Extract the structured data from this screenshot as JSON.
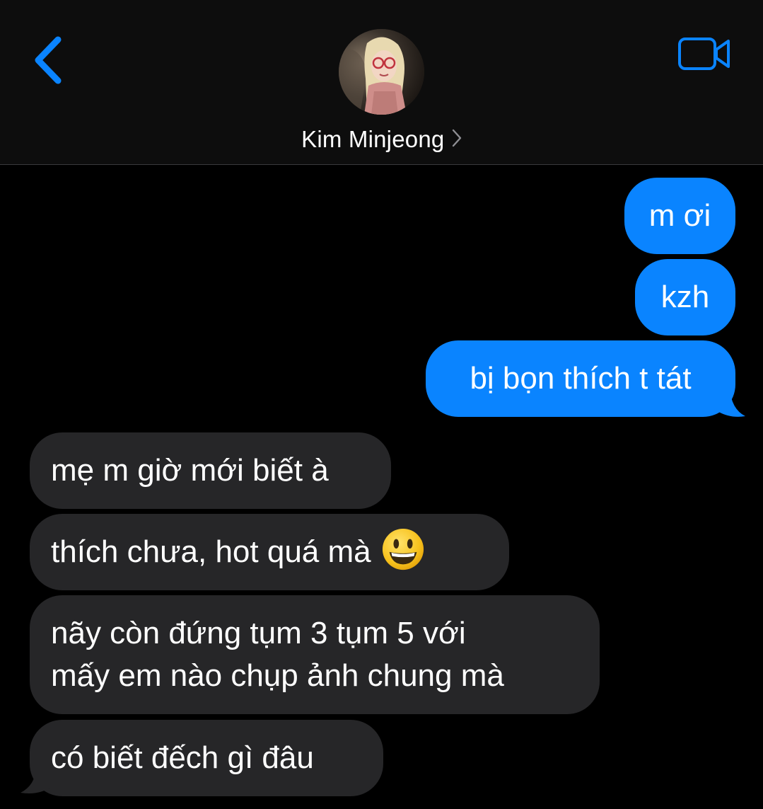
{
  "header": {
    "contact_name": "Kim Minjeong",
    "back_icon": "chevron-left-icon",
    "video_icon": "video-camera-icon",
    "accent_color": "#0a84ff"
  },
  "messages": [
    {
      "direction": "sent",
      "text": "m ơi"
    },
    {
      "direction": "sent",
      "text": "kzh"
    },
    {
      "direction": "sent",
      "text": "bị bọn thích t tát"
    },
    {
      "direction": "received",
      "text": "mẹ m giờ mới biết à"
    },
    {
      "direction": "received",
      "text": "thích chưa, hot quá mà",
      "emoji": "grinning-face-emoji"
    },
    {
      "direction": "received",
      "lines": [
        "nãy còn đứng tụm 3 tụm 5 với",
        "mấy em nào chụp ảnh chung mà"
      ]
    },
    {
      "direction": "received",
      "text": "có biết đếch gì đâu"
    }
  ],
  "colors": {
    "sent_bubble": "#0a84ff",
    "received_bubble": "#262628",
    "background": "#000000"
  }
}
